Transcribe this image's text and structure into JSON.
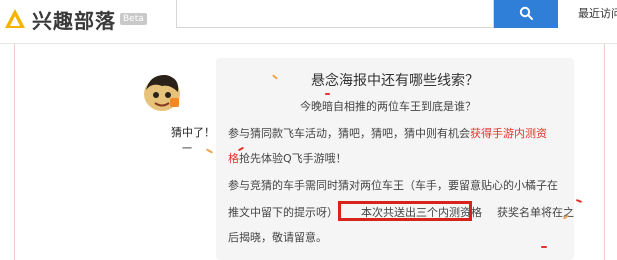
{
  "header": {
    "logo_text": "兴趣部落",
    "logo_badge": "Beta",
    "search_placeholder": "",
    "search_icon": "search-icon",
    "recent_label": "最近访问"
  },
  "post": {
    "title": "悬念海报中还有哪些线索？",
    "question": "今晚暗自相推的两位车王到底是谁？",
    "line1_a": "参与猜同款飞车活动，猜吧，猜吧，猜中则有机会",
    "line1_b": "获得手游内测资",
    "line2_a": "格",
    "line2_b": "抢先体验Q飞手游哦！",
    "line3": "参与竞猜的车手需同时猜对两位车王（车手，要留意贴心的小橘子在",
    "line4_a": "推文中留下的提示呀）",
    "line4_b": "本次共送出三个内测资格",
    "line4_c": "获奖名单将在之",
    "line5": "后揭晓，敬请留意。"
  },
  "side": {
    "label": "猜中了！",
    "label2": "一"
  },
  "colors": {
    "accent": "#2f7fd8",
    "highlight": "#e2342a",
    "box": "#d9221b"
  }
}
